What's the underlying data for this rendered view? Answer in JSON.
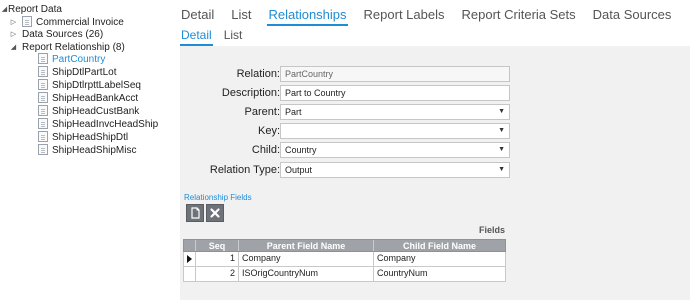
{
  "tree": {
    "root": "Report Data",
    "items": [
      {
        "label": "Commercial Invoice"
      },
      {
        "label": "Data Sources (26)"
      },
      {
        "label": "Report Relationship (8)"
      }
    ],
    "children": [
      "PartCountry",
      "ShipDtlPartLot",
      "ShipDtlrpttLabelSeq",
      "ShipHeadBankAcct",
      "ShipHeadCustBank",
      "ShipHeadInvcHeadShip",
      "ShipHeadShipDtl",
      "ShipHeadShipMisc"
    ]
  },
  "tabs": [
    "Detail",
    "List",
    "Relationships",
    "Report Labels",
    "Report Criteria Sets",
    "Data Sources"
  ],
  "subtabs": [
    "Detail",
    "List"
  ],
  "form": {
    "relation_label": "Relation:",
    "relation_value": "PartCountry",
    "description_label": "Description:",
    "description_value": "Part to Country",
    "parent_label": "Parent:",
    "parent_value": "Part",
    "key_label": "Key:",
    "key_value": "",
    "child_label": "Child:",
    "child_value": "Country",
    "relation_type_label": "Relation Type:",
    "relation_type_value": "Output"
  },
  "relationship_fields": {
    "section_label": "Relationship Fields",
    "grid_title": "Fields",
    "columns": [
      "Seq",
      "Parent Field Name",
      "Child Field Name"
    ],
    "rows": [
      {
        "seq": "1",
        "parent": "Company",
        "child": "Company"
      },
      {
        "seq": "2",
        "parent": "ISOrigCountryNum",
        "child": "CountryNum"
      }
    ]
  },
  "colors": {
    "accent": "#1f8cd4",
    "panel": "#f1f1f1",
    "grid_header": "#9fa3a7"
  }
}
